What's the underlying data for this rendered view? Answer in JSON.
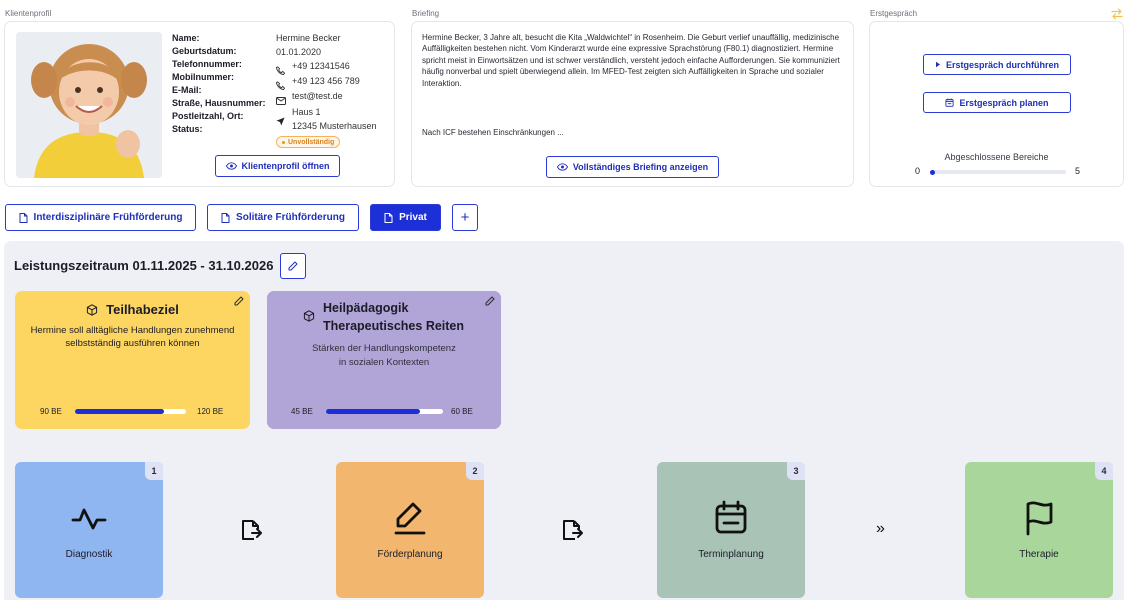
{
  "sections": {
    "client_profile": "Klientenprofil",
    "briefing": "Briefing",
    "first_meeting": "Erstgespräch"
  },
  "profile": {
    "labels": [
      "Name:",
      "Geburtsdatum:",
      "Telefonnummer:",
      "Mobilnummer:",
      "E-Mail:",
      "Straße, Hausnummer:",
      "Postleitzahl, Ort:",
      "Status:"
    ],
    "name": "Hermine Becker",
    "birthdate": "01.01.2020",
    "phone": "+49 12341546",
    "mobile": "+49 123 456 789",
    "email": "test@test.de",
    "street": "Haus 1",
    "city": "12345 Musterhausen",
    "status": "Unvollständig",
    "open_button": "Klientenprofil öffnen"
  },
  "briefing": {
    "text": "Hermine Becker, 3 Jahre alt, besucht die Kita „Waldwichtel“ in Rosenheim. Die Geburt verlief unauffällig, medizinische Auffälligkeiten bestehen nicht. Vom Kinderarzt wurde eine expressive Sprachstörung (F80.1) diagnostiziert. Hermine spricht meist in Einwortsätzen und ist schwer verständlich, versteht jedoch einfache Aufforderungen. Sie kommuniziert häufig nonverbal und spielt überwiegend allein. Im MFED-Test zeigten sich Auffälligkeiten in Sprache und sozialer Interaktion.",
    "text2": "Nach ICF bestehen Einschränkungen ...",
    "show_button": "Vollständiges Briefing anzeigen"
  },
  "first_meeting": {
    "conduct_button": "Erstgespräch durchführen",
    "plan_button": "Erstgespräch planen",
    "completed_label": "Abgeschlossene Bereiche",
    "min": "0",
    "max": "5",
    "progress_fraction": 0.02
  },
  "tabs": [
    {
      "label": "Interdisziplinäre Frühförderung",
      "active": false
    },
    {
      "label": "Solitäre Frühförderung",
      "active": false
    },
    {
      "label": "Privat",
      "active": true
    }
  ],
  "add_tab": "+",
  "period": {
    "title": "Leistungszeitraum 01.11.2025 - 31.10.2026"
  },
  "goals": [
    {
      "title": "Teilhabeziel",
      "description": "Hermine soll alltägliche Handlungen zunehmend selbstständig ausführen können",
      "min_label": "90 BE",
      "max_label": "120 BE",
      "progress_fraction": 0.8,
      "color": "#fdd662"
    },
    {
      "title_line1": "Heilpädagogik",
      "title_line2": "Therapeutisches Reiten",
      "description_line1": "Stärken der Handlungskompetenz",
      "description_line2": "in sozialen Kontexten",
      "min_label": "45 BE",
      "max_label": "60 BE",
      "progress_fraction": 0.8,
      "color": "#b1a4d6"
    }
  ],
  "steps": [
    {
      "number": "1",
      "label": "Diagnostik",
      "icon": "activity-icon",
      "color": "#8fb6f1",
      "badge": "#dfe2f4"
    },
    {
      "number": "2",
      "label": "Förderplanung",
      "icon": "edit-pencil-icon",
      "color": "#f2b66f",
      "badge": "#dfe2f4"
    },
    {
      "number": "3",
      "label": "Terminplanung",
      "icon": "calendar-icon",
      "color": "#a9c3b6",
      "badge": "#dfe2f4"
    },
    {
      "number": "4",
      "label": "Therapie",
      "icon": "flag-icon",
      "color": "#a9d79b",
      "badge": "#dfe2f4"
    }
  ],
  "connectors": {
    "third": "»"
  }
}
